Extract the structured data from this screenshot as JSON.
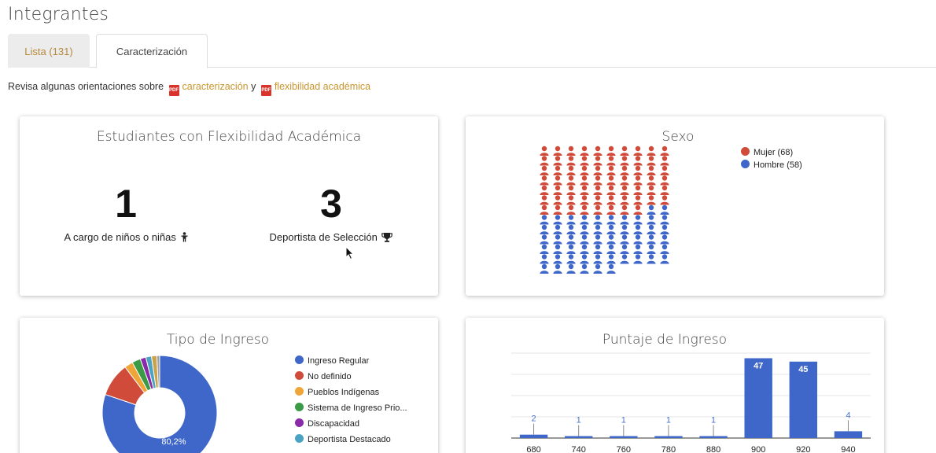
{
  "page": {
    "title": "Integrantes"
  },
  "tabs": [
    {
      "label": "Lista (131)",
      "active": false
    },
    {
      "label": "Caracterización",
      "active": true
    }
  ],
  "info": {
    "prefix": "Revisa algunas orientaciones sobre",
    "link1": "caracterización",
    "connector": "y",
    "link2": "flexibilidad académica"
  },
  "flex_card": {
    "title": "Estudiantes con Flexibilidad Académica",
    "stats": [
      {
        "value": "1",
        "label": "A cargo de niños o niñas",
        "icon": "child-icon"
      },
      {
        "value": "3",
        "label": "Deportista de Selección",
        "icon": "trophy-icon"
      }
    ]
  },
  "colors": {
    "red": "#d14b3a",
    "blue": "#3f67c9",
    "orange": "#efa537",
    "green": "#3a9a45",
    "purple": "#8a2aa8",
    "teal": "#4aa3c3",
    "accent": "#c9962f"
  },
  "chart_data": [
    {
      "type": "pictogram",
      "title": "Sexo",
      "series": [
        {
          "name": "Mujer (68)",
          "value": 68,
          "color": "#d14b3a"
        },
        {
          "name": "Hombre (58)",
          "value": 58,
          "color": "#3f67c9"
        }
      ],
      "legend": "top-right"
    },
    {
      "type": "pie",
      "title": "Tipo de Ingreso",
      "slices": [
        {
          "name": "Ingreso Regular",
          "value": 80.2,
          "color": "#3f67c9"
        },
        {
          "name": "No definido",
          "value": 9.5,
          "color": "#d14b3a"
        },
        {
          "name": "Pueblos Indígenas",
          "value": 2.4,
          "color": "#efa537"
        },
        {
          "name": "Sistema de Ingreso Prio...",
          "value": 2.4,
          "color": "#3a9a45"
        },
        {
          "name": "Discapacidad",
          "value": 1.6,
          "color": "#8a2aa8"
        },
        {
          "name": "Deportista Destacado",
          "value": 1.6,
          "color": "#4aa3c3"
        },
        {
          "name": "",
          "value": 1.5,
          "color": "#c9a24a"
        },
        {
          "name": "",
          "value": 0.8,
          "color": "#a0a0a0"
        }
      ],
      "slice_label": "80,2%",
      "legend": "right"
    },
    {
      "type": "bar",
      "title": "Puntaje de Ingreso",
      "categories": [
        "680",
        "740",
        "760",
        "780",
        "880",
        "900",
        "920",
        "940"
      ],
      "values": [
        2,
        1,
        1,
        1,
        1,
        47,
        45,
        4
      ],
      "data_labels": [
        "2",
        "1",
        "1",
        "1",
        "1",
        "47",
        "45",
        "4"
      ],
      "ylim": [
        0,
        50
      ],
      "grid": true
    }
  ]
}
